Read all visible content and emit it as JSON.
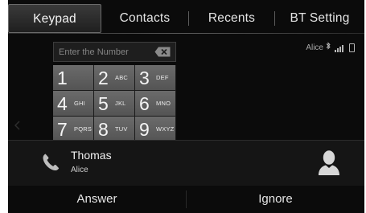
{
  "tabs": [
    {
      "label": "Keypad",
      "active": true
    },
    {
      "label": "Contacts",
      "active": false
    },
    {
      "label": "Recents",
      "active": false
    },
    {
      "label": "BT Setting",
      "active": false
    }
  ],
  "status": {
    "device_name": "Alice",
    "bluetooth_icon": "bluetooth-icon",
    "signal_icon": "signal-icon",
    "battery_icon": "battery-icon"
  },
  "keypad": {
    "number_value": "",
    "placeholder": "Enter the Number",
    "backspace_icon": "backspace-icon",
    "keys": [
      {
        "digit": "1",
        "letters": ""
      },
      {
        "digit": "2",
        "letters": "ABC"
      },
      {
        "digit": "3",
        "letters": "DEF"
      },
      {
        "digit": "4",
        "letters": "GHI"
      },
      {
        "digit": "5",
        "letters": "JKL"
      },
      {
        "digit": "6",
        "letters": "MNO"
      },
      {
        "digit": "7",
        "letters": "PQRS"
      },
      {
        "digit": "8",
        "letters": "TUV"
      },
      {
        "digit": "9",
        "letters": "WXYZ"
      }
    ]
  },
  "incoming_call": {
    "caller_name": "Thomas",
    "device_name": "Alice",
    "phone_icon": "phone-icon",
    "avatar_icon": "person-avatar-icon",
    "answer_label": "Answer",
    "ignore_label": "Ignore"
  },
  "colors": {
    "background": "#0b0b0b",
    "key": "#5f5f5f",
    "text": "#e6e6e6",
    "call_panel": "#151515"
  }
}
